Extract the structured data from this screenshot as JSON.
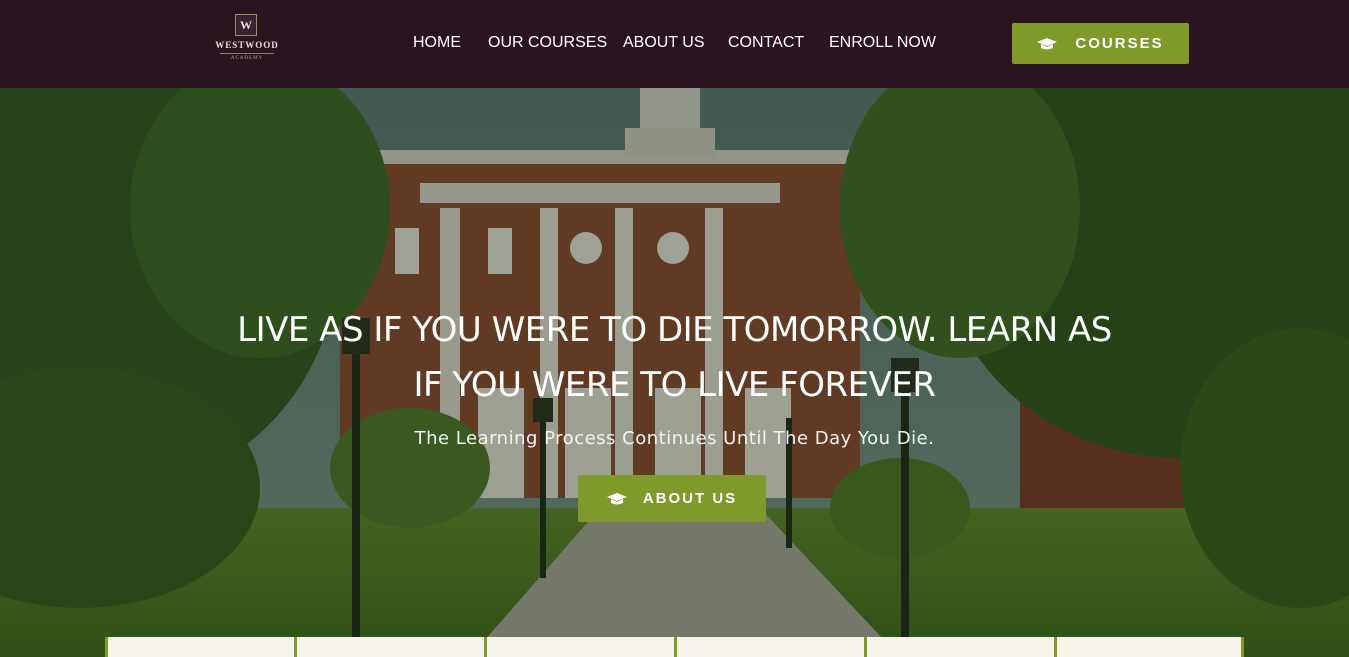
{
  "logo": {
    "letter": "W",
    "name": "WESTWOOD",
    "sub": "ACADEMY"
  },
  "nav": {
    "items": [
      {
        "label": "HOME"
      },
      {
        "label": "OUR COURSES"
      },
      {
        "label": "ABOUT US"
      },
      {
        "label": "CONTACT"
      },
      {
        "label": "ENROLL NOW"
      }
    ]
  },
  "header_button": {
    "label": "COURSES",
    "icon": "graduation-cap-icon"
  },
  "hero": {
    "headline_line1": "LIVE AS IF YOU WERE TO DIE TOMORROW. LEARN AS",
    "headline_line2": "IF YOU WERE TO LIVE FOREVER",
    "subtitle": "The Learning Process Continues Until The Day You Die.",
    "button_label": "ABOUT US",
    "button_icon": "graduation-cap-icon"
  },
  "colors": {
    "header_bg": "#2a1420",
    "accent": "#7f9a2a",
    "card_bg": "#f6f3ea"
  },
  "cards_count_visible": 6
}
